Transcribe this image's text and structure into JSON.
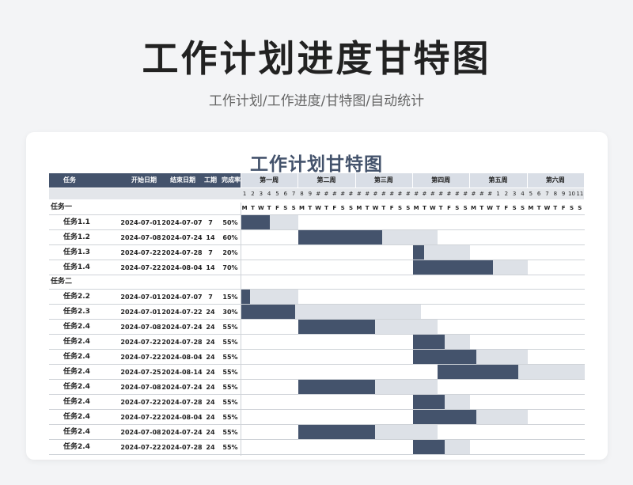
{
  "title": "工作计划进度甘特图",
  "subtitle": "工作计划/工作进度/甘特图/自动统计",
  "sheet_title": "工作计划甘特图",
  "headers": {
    "task": "任务",
    "start": "开始日期",
    "end": "结束日期",
    "duration": "工期",
    "progress": "完成率"
  },
  "weeks": [
    "第一周",
    "第二周",
    "第三周",
    "第四周",
    "第五周",
    "第六周"
  ],
  "day_numbers": [
    "1",
    "2",
    "3",
    "4",
    "5",
    "6",
    "7",
    "8",
    "9",
    "#",
    "#",
    "#",
    "#",
    "#",
    "#",
    "#",
    "#",
    "#",
    "#",
    "#",
    "#",
    "#",
    "#",
    "#",
    "#",
    "#",
    "#",
    "#",
    "#",
    "#",
    "#",
    "1",
    "2",
    "3",
    "4",
    "5",
    "6",
    "7",
    "8",
    "9",
    "10",
    "11"
  ],
  "day_letters": [
    "M",
    "T",
    "W",
    "T",
    "F",
    "S",
    "S",
    "M",
    "T",
    "W",
    "T",
    "F",
    "S",
    "S",
    "M",
    "T",
    "W",
    "T",
    "F",
    "S",
    "S",
    "M",
    "T",
    "W",
    "T",
    "F",
    "S",
    "S",
    "M",
    "T",
    "W",
    "T",
    "F",
    "S",
    "S",
    "M",
    "T",
    "W",
    "T",
    "F",
    "S",
    "S"
  ],
  "groups": [
    {
      "name": "任务一",
      "tasks": [
        {
          "name": "任务1.1",
          "start": "2024-07-01",
          "end": "2024-07-07",
          "duration": "7",
          "progress": "50%"
        },
        {
          "name": "任务1.2",
          "start": "2024-07-08",
          "end": "2024-07-24",
          "duration": "14",
          "progress": "60%"
        },
        {
          "name": "任务1.3",
          "start": "2024-07-22",
          "end": "2024-07-28",
          "duration": "7",
          "progress": "20%"
        },
        {
          "name": "任务1.4",
          "start": "2024-07-22",
          "end": "2024-08-04",
          "duration": "14",
          "progress": "70%"
        }
      ]
    },
    {
      "name": "任务二",
      "tasks": [
        {
          "name": "任务2.2",
          "start": "2024-07-01",
          "end": "2024-07-07",
          "duration": "7",
          "progress": "15%"
        },
        {
          "name": "任务2.3",
          "start": "2024-07-01",
          "end": "2024-07-22",
          "duration": "24",
          "progress": "30%"
        },
        {
          "name": "任务2.4",
          "start": "2024-07-08",
          "end": "2024-07-24",
          "duration": "24",
          "progress": "55%"
        },
        {
          "name": "任务2.4",
          "start": "2024-07-22",
          "end": "2024-07-28",
          "duration": "24",
          "progress": "55%"
        },
        {
          "name": "任务2.4",
          "start": "2024-07-22",
          "end": "2024-08-04",
          "duration": "24",
          "progress": "55%"
        },
        {
          "name": "任务2.4",
          "start": "2024-07-25",
          "end": "2024-08-14",
          "duration": "24",
          "progress": "55%"
        },
        {
          "name": "任务2.4",
          "start": "2024-07-08",
          "end": "2024-07-24",
          "duration": "24",
          "progress": "55%"
        },
        {
          "name": "任务2.4",
          "start": "2024-07-22",
          "end": "2024-07-28",
          "duration": "24",
          "progress": "55%"
        },
        {
          "name": "任务2.4",
          "start": "2024-07-22",
          "end": "2024-08-04",
          "duration": "24",
          "progress": "55%"
        },
        {
          "name": "任务2.4",
          "start": "2024-07-08",
          "end": "2024-07-24",
          "duration": "24",
          "progress": "55%"
        },
        {
          "name": "任务2.4",
          "start": "2024-07-22",
          "end": "2024-07-28",
          "duration": "24",
          "progress": "55%"
        }
      ]
    }
  ],
  "colors": {
    "accent": "#44536c",
    "plan": "#dde1e7",
    "header_band": "#d9dee6"
  }
}
